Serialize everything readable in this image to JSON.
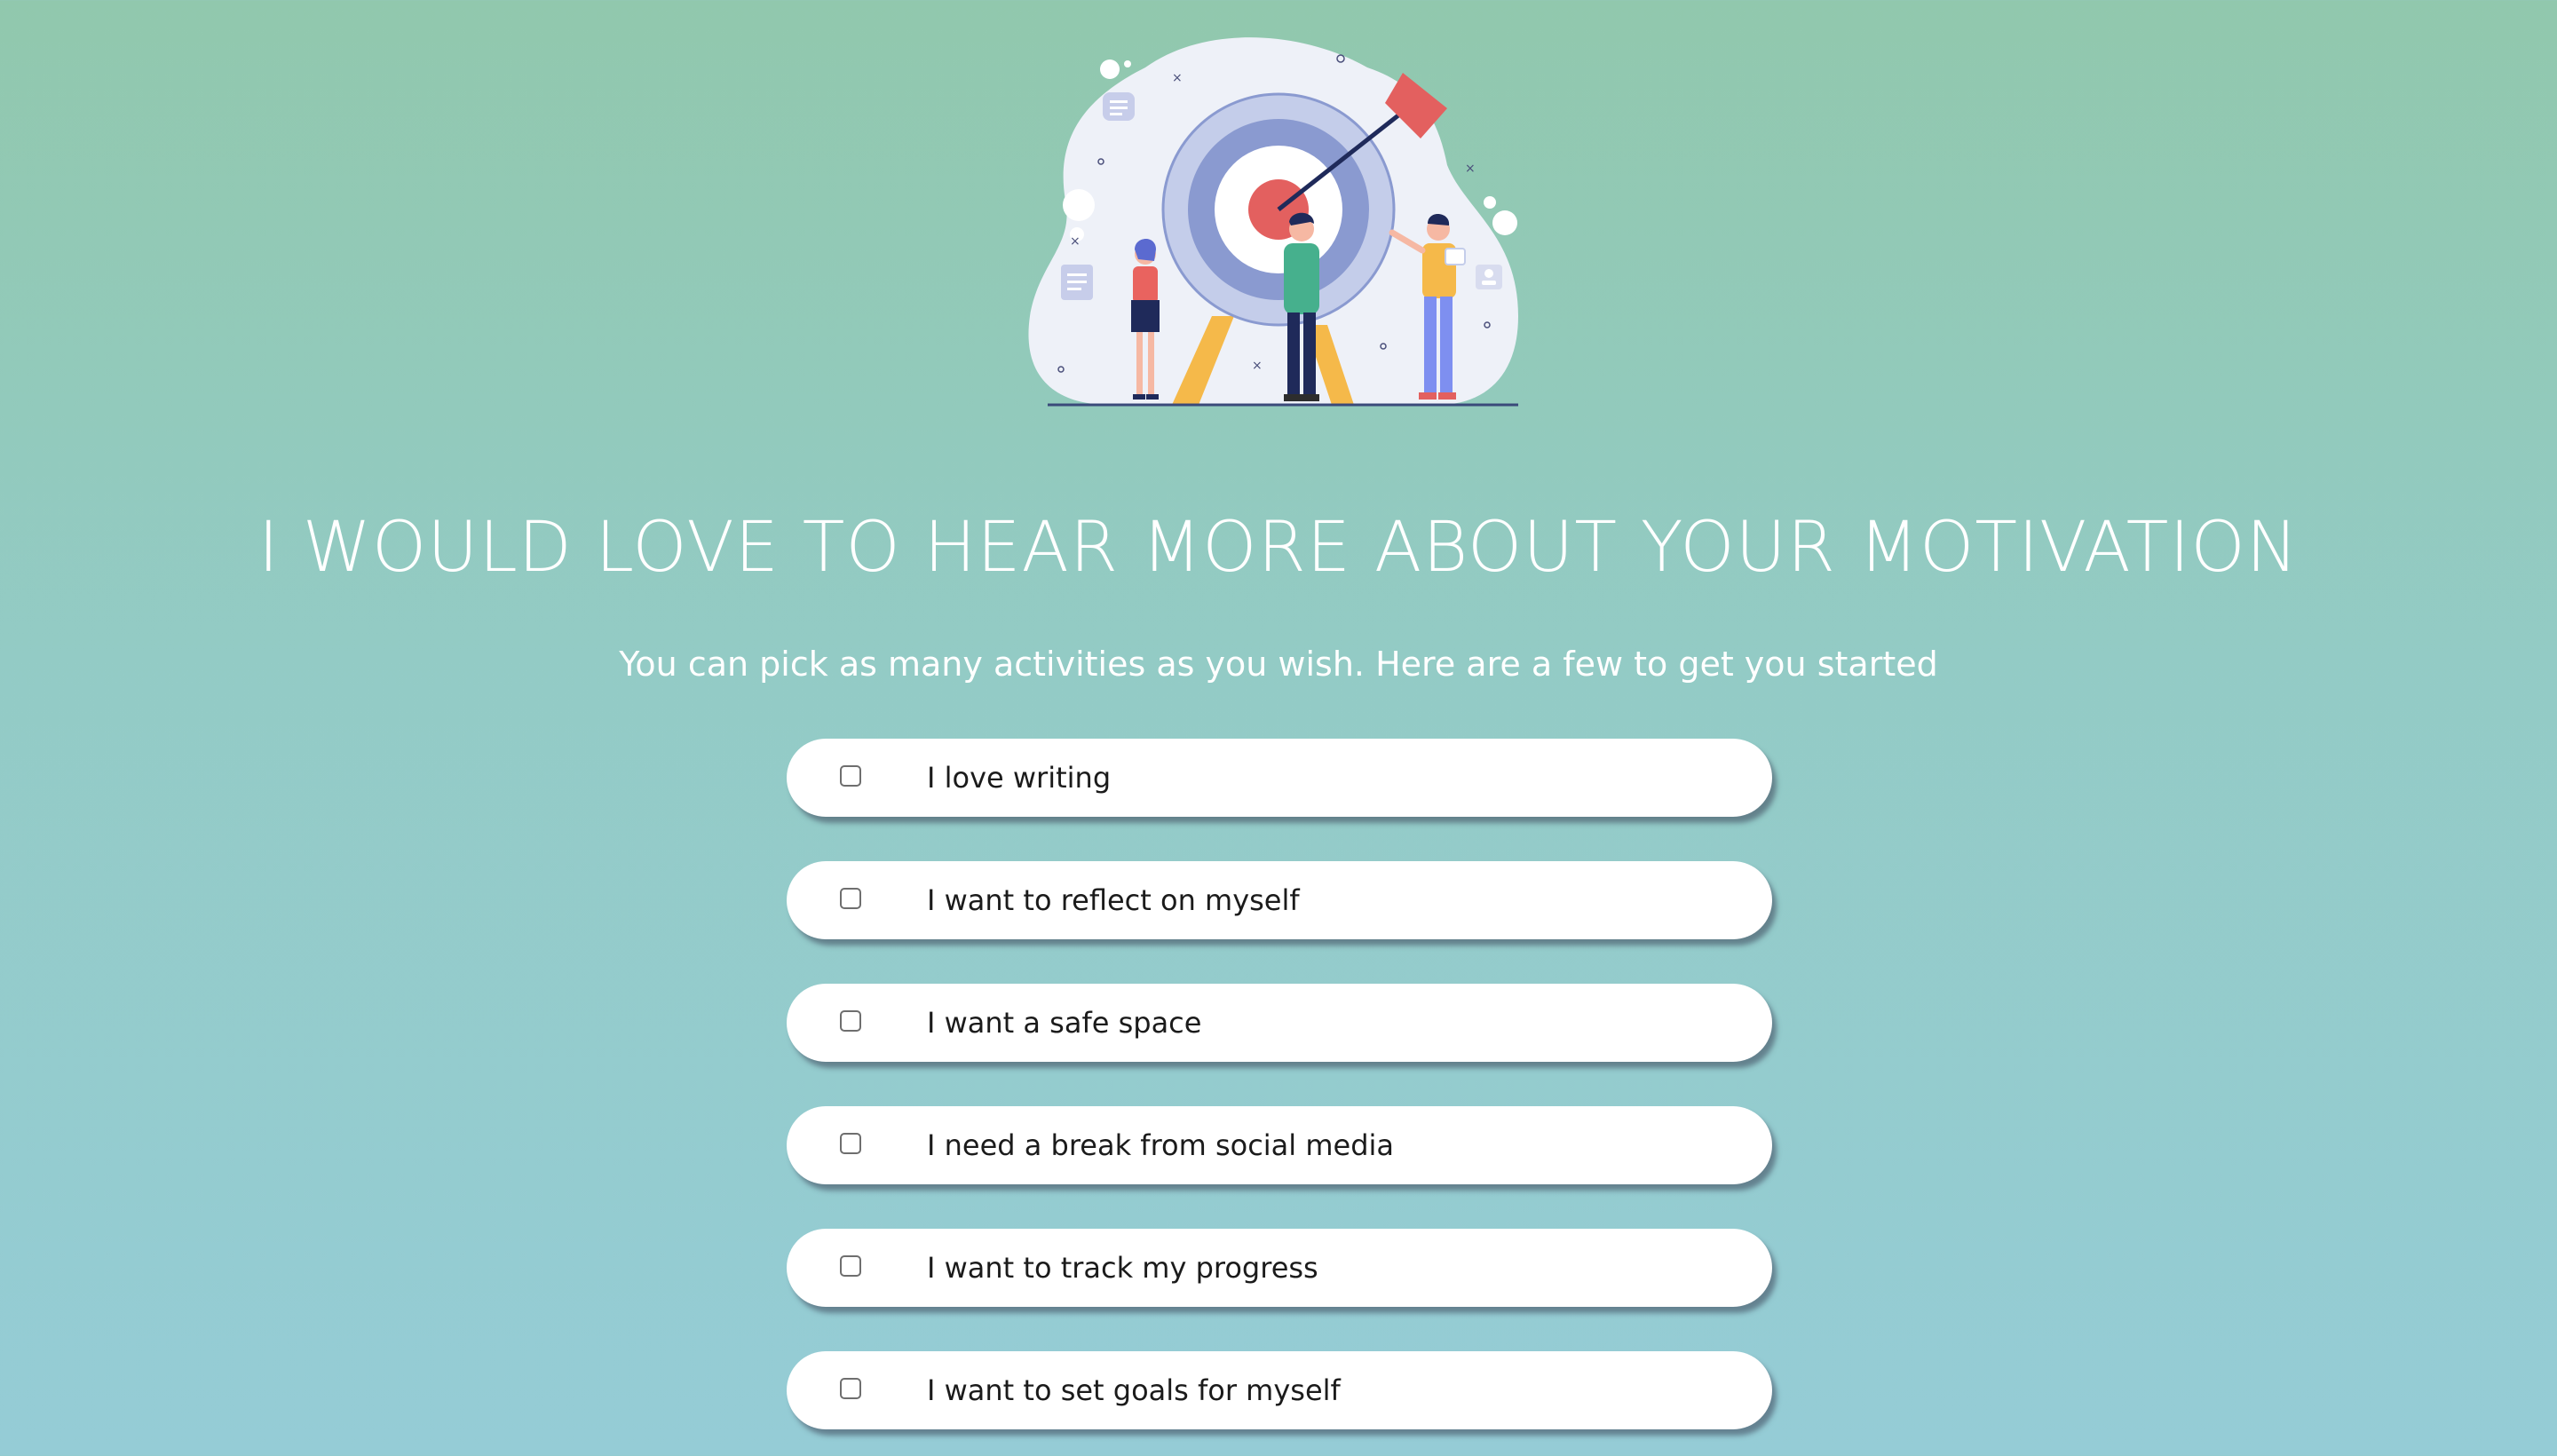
{
  "hero": {
    "illustration": "target-goal-illustration"
  },
  "page_title": "I WOULD LOVE TO HEAR MORE ABOUT YOUR MOTIVATION",
  "subtitle": "You can pick as many activities as you wish. Here are a few to get you started",
  "options": [
    {
      "label": "I love writing",
      "checked": false
    },
    {
      "label": "I want to reflect on myself",
      "checked": false
    },
    {
      "label": "I want a safe space",
      "checked": false
    },
    {
      "label": "I need a break from social media",
      "checked": false
    },
    {
      "label": "I want to track my progress",
      "checked": false
    },
    {
      "label": "I want to set goals for myself",
      "checked": false
    }
  ],
  "colors": {
    "background_top": "#91c8ad",
    "background_bottom": "#95ccd6",
    "card": "#ffffff",
    "text": "#1b1b1b"
  }
}
